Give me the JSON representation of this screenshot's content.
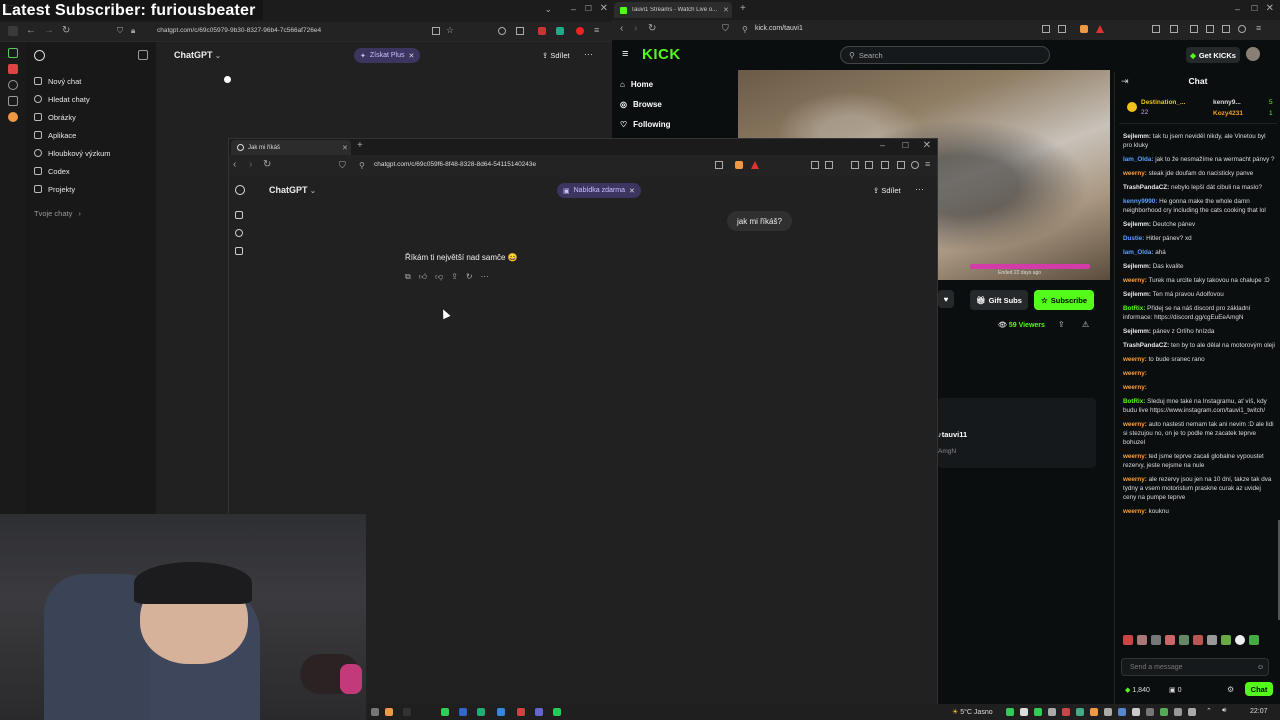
{
  "overlay": {
    "title": "Latest Subscriber: furiousbeater"
  },
  "left_browser": {
    "url": "chatgpt.com/c/69c05979-9b30-8327-96b4-7c566af726e4",
    "model": "ChatGPT",
    "upgrade_label": "Získat Plus",
    "share_label": "Sdílet",
    "sidebar": {
      "items": [
        {
          "label": "Nový chat"
        },
        {
          "label": "Hledat chaty"
        },
        {
          "label": "Obrázky"
        },
        {
          "label": "Aplikace"
        },
        {
          "label": "Hloubkový výzkum"
        },
        {
          "label": "Codex"
        },
        {
          "label": "Projekty"
        }
      ],
      "section": "Tvoje chaty"
    }
  },
  "mid_window": {
    "tab_title": "Jak mi říkáš",
    "url": "chatgpt.com/c/69c059f6-8f48-8328-8d64-54115140243e",
    "model": "ChatGPT",
    "offer_label": "Nabídka zdarma",
    "share_label": "Sdílet",
    "user_message": "jak mi říkáš?",
    "assistant_message": "Říkám ti největší nad samče 😄"
  },
  "right_browser": {
    "tab_title": "Tauvi1 Streams - Watch Live o...",
    "url": "kick.com/tauvi1",
    "logo": "KICK",
    "search_placeholder": "Search",
    "get_kicks_label": "Get KICKs",
    "nav": [
      {
        "label": "Home"
      },
      {
        "label": "Browse"
      },
      {
        "label": "Following"
      }
    ],
    "video_caption": "Ended 22 days ago",
    "gift_subs_label": "Gift Subs",
    "subscribe_label": "Subscribe",
    "viewers": "59 Viewers",
    "channel_name": "tauvi11",
    "channel_sub": "AmgN",
    "chat": {
      "title": "Chat",
      "top_user1": "Destination_...",
      "top_user1_count": "22",
      "top_user2": "kenny9...",
      "top_user2_count": "5",
      "top_user3": "Kozy4231",
      "top_user3_count": "1",
      "messages": [
        {
          "user": "Sejlemm:",
          "text": "tak tu jsem neviděl nikdy, ale Vinetou byl pro kluky",
          "color": "#e8e8e8"
        },
        {
          "user": "Iam_Olda:",
          "text": "jak to že nesmažíme na wermacht pánvy ?",
          "color": "#5aa0ff"
        },
        {
          "user": "weerny:",
          "text": "steak jde doufam do nacisticky panve",
          "color": "#ff9f3f"
        },
        {
          "user": "TrashPandaCZ:",
          "text": "nebylo lepší dát cibuli na maslo?",
          "color": "#e8e8e8"
        },
        {
          "user": "kenny9990:",
          "text": "He gonna make the whole damn neighborhood cry including the cats cooking that lol",
          "color": "#5aa0ff"
        },
        {
          "user": "Sejlemm:",
          "text": "Deutche pánev",
          "color": "#e8e8e8"
        },
        {
          "user": "Dustie:",
          "text": "Hitler pánev? xd",
          "color": "#5aa0ff"
        },
        {
          "user": "Iam_Olda:",
          "text": "ahá",
          "color": "#5aa0ff"
        },
        {
          "user": "Sejlemm:",
          "text": "Das kvalite",
          "color": "#e8e8e8"
        },
        {
          "user": "weerny:",
          "text": "Turek ma urcite taky takovou na chalupe :D",
          "color": "#ff9f3f"
        },
        {
          "user": "Sejlemm:",
          "text": "Ten má pravou Adolfovou",
          "color": "#e8e8e8"
        },
        {
          "user": "BotRix:",
          "text": "Přidej se na náš discord pro základní informace: https://discord.gg/cgEuEeAmgN",
          "color": "#53fc18"
        },
        {
          "user": "Sejlemm:",
          "text": "pánev z Orlího hnízda",
          "color": "#e8e8e8"
        },
        {
          "user": "TrashPandaCZ:",
          "text": "ten by to ale dělal na motorovým oleji",
          "color": "#e8e8e8"
        },
        {
          "user": "weerny:",
          "text": "to bude sranec rano",
          "color": "#ff9f3f"
        },
        {
          "user": "weerny:",
          "text": "",
          "color": "#ff9f3f"
        },
        {
          "user": "weerny:",
          "text": "",
          "color": "#ff9f3f"
        },
        {
          "user": "BotRix:",
          "text": "Sleduj mne také na Instagramu, ať víš, kdy budu live https://www.instagram.com/tauvi1_twitch/",
          "color": "#53fc18"
        },
        {
          "user": "weerny:",
          "text": "auto nastesti nemam tak ani nevim :D ale lidi si stezujou no, on je to podle me zacatek teprve bohuzel",
          "color": "#ff9f3f"
        },
        {
          "user": "weerny:",
          "text": "ted jsme teprve zacali globalne vypoustet rezervy, jeste nejsme na nule",
          "color": "#ff9f3f"
        },
        {
          "user": "weerny:",
          "text": "ale rezervy jsou jen na 10 dní, takze tak dva tydny a vsem motoristum praskne curak az uvidej ceny na pumpe teprve",
          "color": "#ff9f3f"
        },
        {
          "user": "weerny:",
          "text": "kouknu",
          "color": "#ff9f3f"
        }
      ],
      "input_placeholder": "Send a message",
      "kicks_count": "1,840",
      "points": "0",
      "send_label": "Chat"
    }
  },
  "taskbar": {
    "weather": "5°C Jasno",
    "time": "22:07"
  }
}
